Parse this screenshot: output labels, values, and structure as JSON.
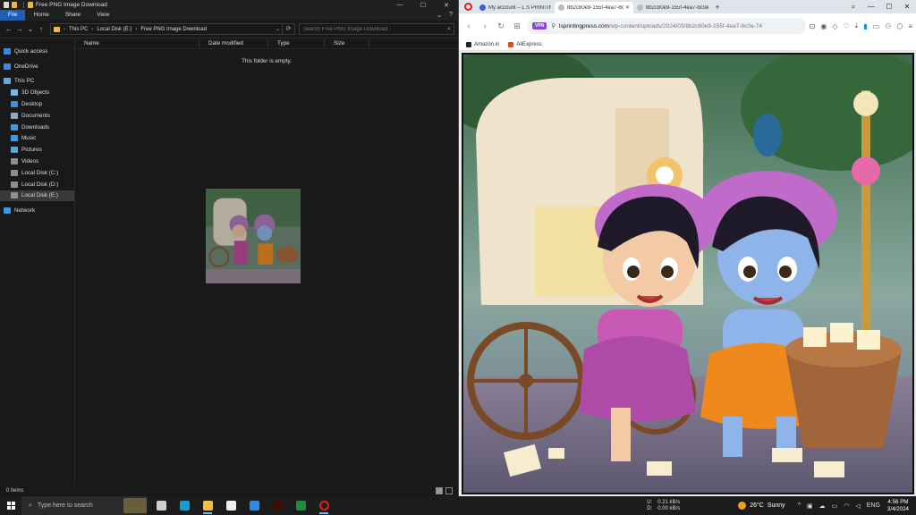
{
  "explorer": {
    "title": "Free PNG Image Download",
    "window_controls": {
      "minimize": "—",
      "maximize": "☐",
      "close": "✕"
    },
    "ribbon": {
      "tabs": [
        "File",
        "Home",
        "Share",
        "View"
      ],
      "expand": "⌄",
      "help": "?"
    },
    "nav": {
      "back": "←",
      "forward": "→",
      "recent": "⌄",
      "up": "↑"
    },
    "address": {
      "crumbs": [
        "This PC",
        "Local Disk (E:)",
        "Free PNG Image Download"
      ],
      "separator": "›",
      "dropdown": "⌄",
      "refresh": "⟳"
    },
    "search": {
      "placeholder": "Search Free PNG Image Download",
      "icon": "⌕"
    },
    "sidebar": [
      {
        "label": "Quick access",
        "icon": "star-icon",
        "color": "#3c8ae0"
      },
      {
        "label": "OneDrive",
        "icon": "cloud-icon",
        "color": "#3c8ae0"
      },
      {
        "label": "This PC",
        "icon": "monitor-icon",
        "color": "#5aaae8"
      },
      {
        "label": "3D Objects",
        "icon": "cube-icon",
        "color": "#79b6f0"
      },
      {
        "label": "Desktop",
        "icon": "desktop-icon",
        "color": "#3d8fd6"
      },
      {
        "label": "Documents",
        "icon": "documents-icon",
        "color": "#9aa7b5"
      },
      {
        "label": "Downloads",
        "icon": "download-icon",
        "color": "#3a9ae8"
      },
      {
        "label": "Music",
        "icon": "music-icon",
        "color": "#3a9ae8"
      },
      {
        "label": "Pictures",
        "icon": "pictures-icon",
        "color": "#5aa6d8"
      },
      {
        "label": "Videos",
        "icon": "videos-icon",
        "color": "#8a8fa0"
      },
      {
        "label": "Local Disk (C:)",
        "icon": "drive-icon",
        "color": "#8a8f98"
      },
      {
        "label": "Local Disk (D:)",
        "icon": "drive-icon",
        "color": "#8a8f98"
      },
      {
        "label": "Local Disk (E:)",
        "icon": "drive-icon",
        "color": "#8a8f98",
        "selected": true
      },
      {
        "label": "Network",
        "icon": "network-icon",
        "color": "#3a9ae8"
      }
    ],
    "columns": [
      "Name",
      "Date modified",
      "Type",
      "Size"
    ],
    "empty_text": "This folder is empty.",
    "status": "0 items"
  },
  "browser": {
    "tabs": [
      {
        "label": "My account – L S PRINTING",
        "favicon": "ls-favicon",
        "active": false
      },
      {
        "label": "8b2c80e9-155f-4ea7-8c0e",
        "favicon": "image-favicon",
        "active": true
      },
      {
        "label": "8b2c80e9-155f-4ea7-8c0e",
        "favicon": "image-favicon",
        "active": false
      }
    ],
    "new_tab": "+",
    "window_controls": {
      "search": "⌕",
      "minimize": "—",
      "maximize": "☐",
      "close": "✕"
    },
    "nav": {
      "back": "‹",
      "forward": "›",
      "reload": "↻",
      "speed_dial": "⊞"
    },
    "url": {
      "vpn": "VPN",
      "lock": "⚲",
      "host": "lsprintingpress.com",
      "path": "/wp-content/uploads/2024/03/8b2c80e9-155f-4ea7-8c0e-74"
    },
    "toolbar_icons": [
      "screenshot-icon",
      "camera-icon",
      "shield-icon",
      "heart-icon",
      "download-icon",
      "battery-icon",
      "wallet-icon",
      "account-icon",
      "box-icon",
      "menu-icon"
    ],
    "bookmarks": [
      {
        "label": "Amazon.in",
        "color": "#222"
      },
      {
        "label": "AliExpress",
        "color": "#e64a19"
      }
    ]
  },
  "taskbar": {
    "search_placeholder": "Type here to search",
    "apps": [
      {
        "name": "task-view",
        "color": "#cfcfcf"
      },
      {
        "name": "edge",
        "color": "#1d9bd1"
      },
      {
        "name": "file-explorer",
        "color": "#f0c040",
        "active": true
      },
      {
        "name": "store",
        "color": "#f0f0f0"
      },
      {
        "name": "mail",
        "color": "#2f8ae0"
      },
      {
        "name": "illustrator",
        "color": "#3a1004"
      },
      {
        "name": "sheets",
        "color": "#1e8c3c"
      },
      {
        "name": "opera",
        "color": "#e0201c",
        "active": true
      }
    ],
    "network": {
      "up_label": "U:",
      "up_value": "0.21 kB/s",
      "down_label": "D:",
      "down_value": "0.00 kB/s"
    },
    "weather": {
      "temp": "26°C",
      "condition": "Sunny"
    },
    "tray": {
      "chevron": "^",
      "language": "ENG"
    },
    "clock": {
      "time": "4:56 PM",
      "date": "3/4/2024"
    }
  }
}
